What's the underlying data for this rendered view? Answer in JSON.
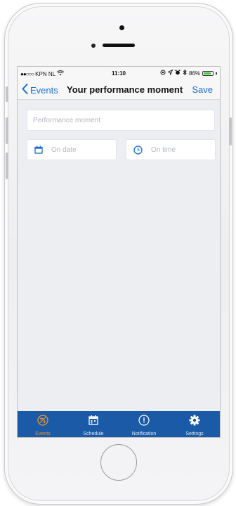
{
  "status_bar": {
    "carrier": "KPN NL",
    "time": "11:10",
    "battery": "86%",
    "battery_level": 0.86
  },
  "nav": {
    "back_label": "Events",
    "title": "Your performance moment",
    "save_label": "Save"
  },
  "form": {
    "moment_placeholder": "Performance moment",
    "date_placeholder": "On date",
    "time_placeholder": "On time"
  },
  "tabs": [
    {
      "label": "Events",
      "icon": "plane-circle-icon",
      "active": true
    },
    {
      "label": "Schedule",
      "icon": "calendar-icon",
      "active": false
    },
    {
      "label": "Notification",
      "icon": "exclamation-circle-icon",
      "active": false
    },
    {
      "label": "Settings",
      "icon": "gear-icon",
      "active": false
    }
  ],
  "colors": {
    "accent": "#1a6ed8",
    "tab_bar": "#1b5aa7",
    "tab_active": "#e9962f",
    "background": "#eceef1"
  }
}
